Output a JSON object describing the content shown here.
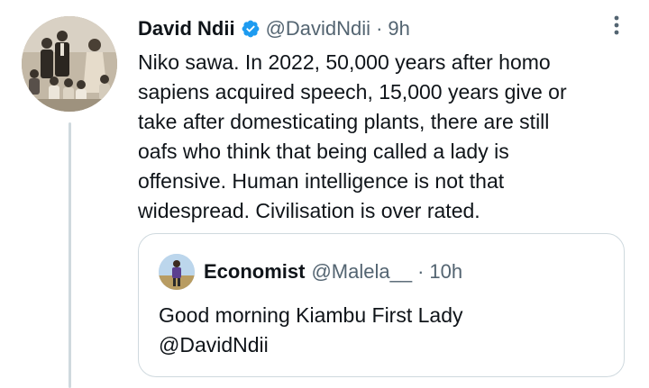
{
  "tweet": {
    "author_name": "David Ndii",
    "author_handle": "@DavidNdii",
    "separator": "·",
    "time": "9h",
    "text": "Niko sawa. In 2022, 50,000 years after homo\nsapiens acquired speech, 15,000 years give or\ntake after domesticating plants, there are still\noafs who think that being called a lady is\noffensive. Human intelligence is not that\nwidespread. Civilisation is over rated.",
    "verified_icon": "verified-badge-icon",
    "more_icon": "more-options-icon",
    "colors": {
      "verified": "#1d9bf0",
      "secondary_text": "#536471",
      "border": "#cfd9de"
    }
  },
  "quote": {
    "author_name": "Economist",
    "author_handle": "@Malela__",
    "separator": "·",
    "time": "10h",
    "text": "Good morning Kiambu First Lady\n@DavidNdii"
  }
}
